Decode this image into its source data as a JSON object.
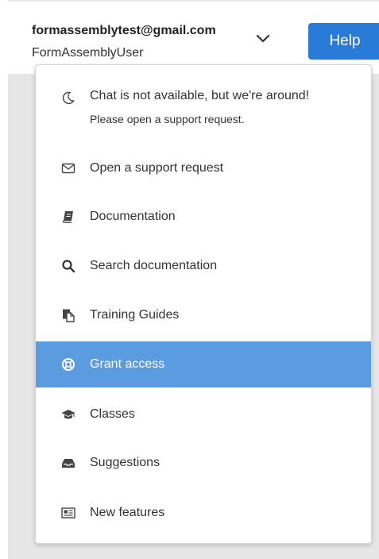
{
  "header": {
    "email": "formassemblytest@gmail.com",
    "username": "FormAssemblyUser",
    "help_label": "Help"
  },
  "menu": {
    "chat_title": "Chat is not available, but we're around!",
    "chat_subtitle": "Please open a support request.",
    "items": [
      {
        "label": "Open a support request",
        "icon": "envelope-icon"
      },
      {
        "label": "Documentation",
        "icon": "book-icon"
      },
      {
        "label": "Search documentation",
        "icon": "search-icon"
      },
      {
        "label": "Training Guides",
        "icon": "copy-icon"
      },
      {
        "label": "Grant access",
        "icon": "life-ring-icon"
      },
      {
        "label": "Classes",
        "icon": "graduation-cap-icon"
      },
      {
        "label": "Suggestions",
        "icon": "inbox-icon"
      },
      {
        "label": "New features",
        "icon": "newspaper-icon"
      }
    ],
    "active_item": "Grant access"
  },
  "colors": {
    "accent": "#2a7ad8",
    "active_item_bg": "#5b9be0",
    "page_bg": "#e6e6e6"
  }
}
